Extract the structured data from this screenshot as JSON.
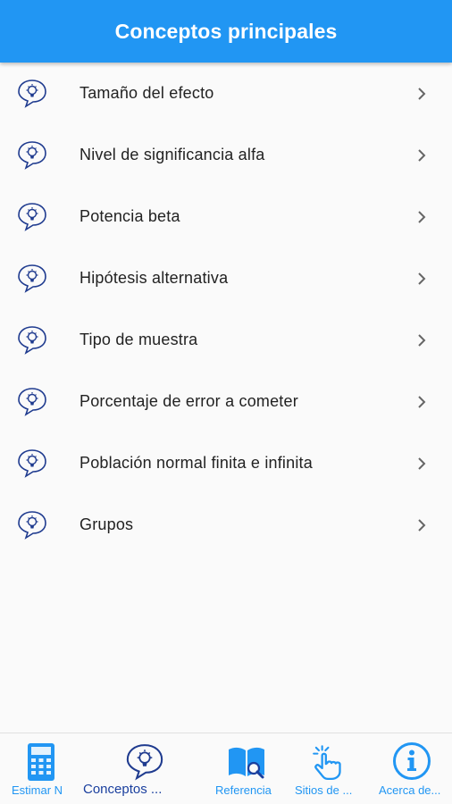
{
  "app_bar": {
    "title": "Conceptos principales"
  },
  "concepts": [
    {
      "label": "Tamaño del efecto",
      "icon": "idea-bubble-icon"
    },
    {
      "label": "Nivel de significancia alfa",
      "icon": "idea-bubble-icon"
    },
    {
      "label": "Potencia beta",
      "icon": "idea-bubble-icon"
    },
    {
      "label": "Hipótesis alternativa",
      "icon": "idea-bubble-icon"
    },
    {
      "label": "Tipo de muestra",
      "icon": "idea-bubble-icon"
    },
    {
      "label": "Porcentaje de error a cometer",
      "icon": "idea-bubble-icon"
    },
    {
      "label": "Población normal finita e infinita",
      "icon": "idea-bubble-icon"
    },
    {
      "label": "Grupos",
      "icon": "idea-bubble-icon"
    }
  ],
  "bottom_nav": {
    "items": [
      {
        "label": "Estimar N",
        "icon": "calculator-icon"
      },
      {
        "label": "Conceptos ...",
        "icon": "idea-bubble-icon",
        "active": true
      },
      {
        "label": "Referencia",
        "icon": "book-search-icon"
      },
      {
        "label": "Sitios de ...",
        "icon": "tap-hand-icon"
      },
      {
        "label": "Acerca de...",
        "icon": "info-icon"
      }
    ]
  },
  "colors": {
    "primary": "#2196f3",
    "active_label": "#1a3f9e",
    "icon_navy": "#1f3b8f"
  }
}
